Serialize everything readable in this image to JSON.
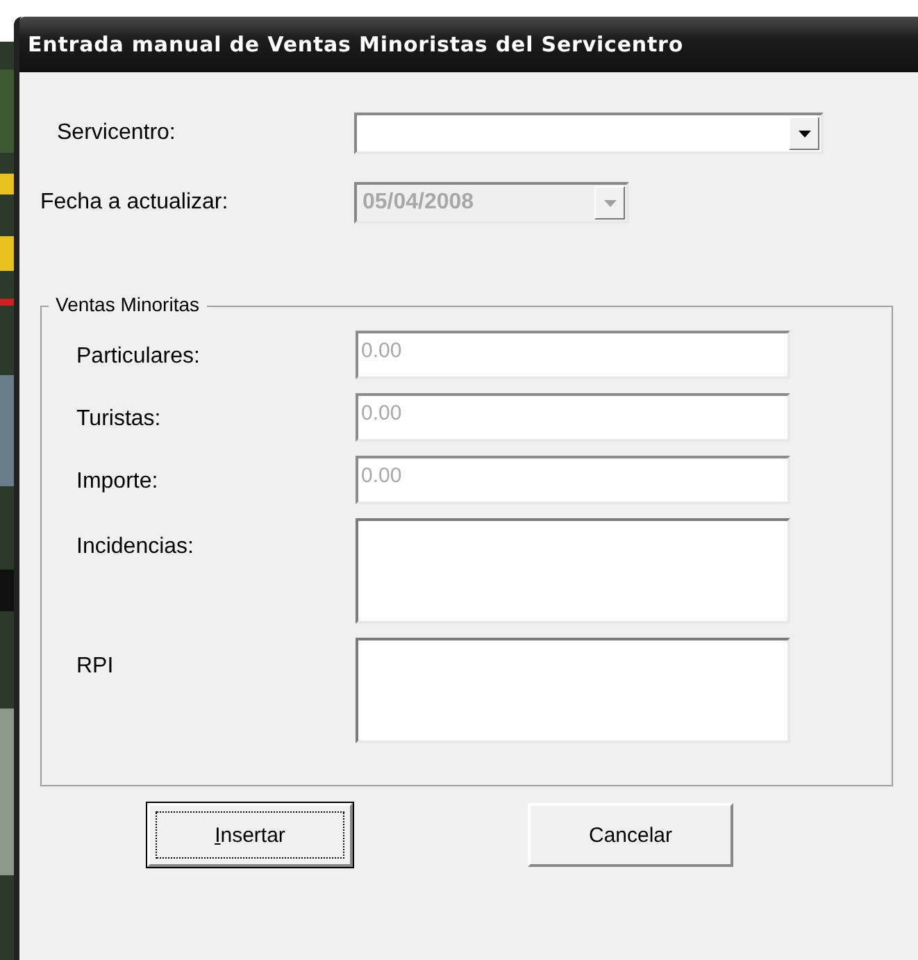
{
  "window": {
    "title": "Entrada manual de Ventas Minoristas del Servicentro"
  },
  "header_fields": [
    {
      "label": "Servicentro:",
      "kind": "combo",
      "disabled": false
    },
    {
      "label": "Fecha a actualizar:",
      "kind": "combo",
      "value": "05/04/2008",
      "disabled": true
    }
  ],
  "group": {
    "title": "Ventas Minoritas",
    "fields": [
      {
        "label": "Particulares:",
        "kind": "text",
        "value": "0.00",
        "disabled": true
      },
      {
        "label": "Turistas:",
        "kind": "text",
        "value": "0.00",
        "disabled": true
      },
      {
        "label": "Importe:",
        "kind": "text",
        "value": "0.00",
        "disabled": true
      },
      {
        "label": "Incidencias:",
        "kind": "memo",
        "disabled": false
      },
      {
        "label": "RPI",
        "kind": "memo",
        "disabled": false
      }
    ]
  },
  "buttons": [
    {
      "label": "Insertar",
      "default": true,
      "mnemonic": true
    },
    {
      "label": "Cancelar",
      "default": false,
      "mnemonic": false
    }
  ]
}
